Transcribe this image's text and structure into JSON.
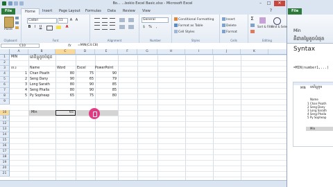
{
  "window": {
    "title": "Bo...  ...bokio Excel Basic.xlsx - Microsoft Excel"
  },
  "tabs": [
    "File",
    "Home",
    "Insert",
    "Page Layout",
    "Formulas",
    "Data",
    "Review",
    "View"
  ],
  "ribbon": {
    "clipboard": {
      "paste": "Paste",
      "label": "Clipboard"
    },
    "font": {
      "name": "Calibri",
      "size": "11",
      "label": "Font"
    },
    "alignment": {
      "label": "Alignment"
    },
    "number": {
      "format": "General",
      "label": "Number",
      "percent": "%"
    },
    "styles": {
      "conditional": "Conditional Formatting",
      "table": "Format as Table",
      "cell": "Cell Styles",
      "label": "Styles"
    },
    "cells": {
      "insert": "Insert",
      "delete": "Delete",
      "format": "Format",
      "label": "Cells"
    },
    "editing": {
      "sort": "Sort & Filter",
      "find": "Find & Select",
      "label": "Editing"
    }
  },
  "formula_bar": {
    "cell_ref": "C10",
    "fx": "fx",
    "formula": "=MIN(C4:C8)"
  },
  "columns": [
    "A",
    "B",
    "C",
    "D",
    "E",
    "F",
    "G",
    "H",
    "I",
    "J",
    "K"
  ],
  "rows": [
    "1",
    "2",
    "3",
    "4",
    "5",
    "6",
    "7",
    "8",
    "9",
    "10",
    "11",
    "12",
    "13",
    "14",
    "15",
    "16",
    "17",
    "18",
    "19",
    "20",
    "21",
    "22",
    "23"
  ],
  "sheet": {
    "a1": "MIN",
    "b1": "គេពិន្ទុតូចបំផុត",
    "a3": "ល.រ",
    "headers": [
      "Name",
      "Word",
      "Excel",
      "PowerPoint"
    ],
    "data": [
      {
        "no": "1",
        "name": "Chan Pisath",
        "word": "80",
        "excel": "75",
        "ppt": "90"
      },
      {
        "no": "2",
        "name": "Seng Dany",
        "word": "90",
        "excel": "65",
        "ppt": "79"
      },
      {
        "no": "3",
        "name": "Long Sarath",
        "word": "80",
        "excel": "90",
        "ppt": "85"
      },
      {
        "no": "4",
        "name": "Seng Phalla",
        "word": "80",
        "excel": "90",
        "ppt": "85"
      },
      {
        "no": "5",
        "name": "Py Sopheap",
        "word": "65",
        "excel": "75",
        "ppt": "80"
      }
    ],
    "min_label": "Min",
    "min_value": "65"
  },
  "right_window": {
    "tab": "File",
    "title": "Min",
    "subtitle": "គឺជាតម្លៃតូចបំផុត",
    "syntax": "Syntax",
    "formula": "=MIN(number1,...)",
    "mini_a1": "MIN",
    "mini_b1": "គេពិន្ទុតូច",
    "mini_header": "Name",
    "mini_names": [
      "1 Chan Pisath",
      "2 Seng Dany",
      "3 Long Sarath",
      "4 Seng Phalla",
      "5 Py Sopheap"
    ],
    "mini_min": "Min"
  }
}
